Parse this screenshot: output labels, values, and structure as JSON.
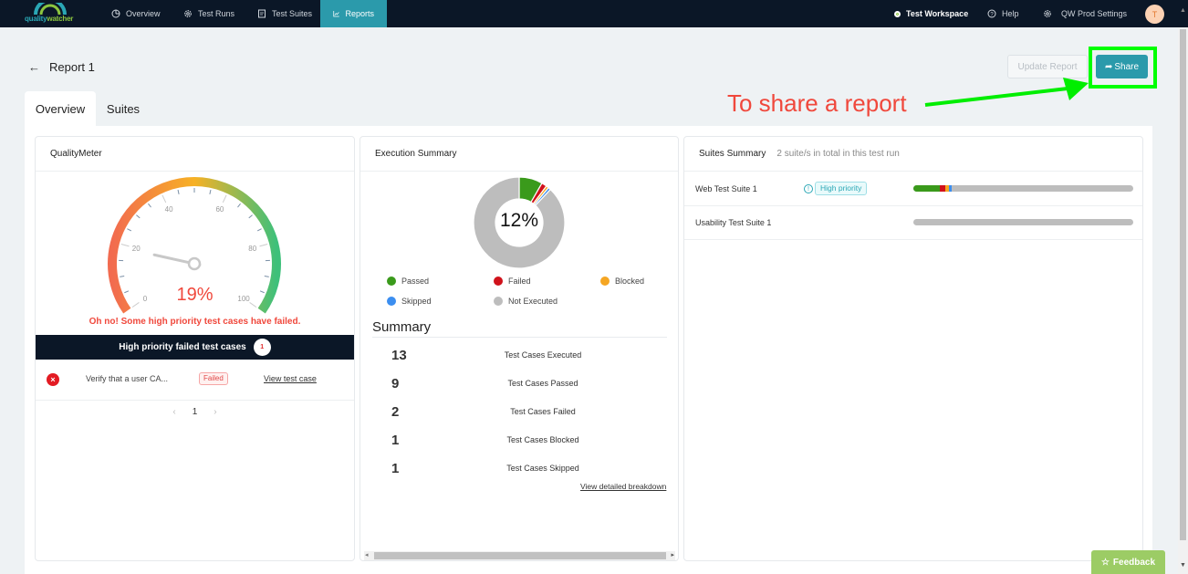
{
  "app": {
    "logo_part1": "quality",
    "logo_part2": "watcher"
  },
  "nav": {
    "items": [
      {
        "label": "Overview",
        "icon": "pie-chart-icon",
        "active": false
      },
      {
        "label": "Test Runs",
        "icon": "gear-icon",
        "active": false
      },
      {
        "label": "Test Suites",
        "icon": "clipboard-icon",
        "active": false
      },
      {
        "label": "Reports",
        "icon": "line-chart-icon",
        "active": true
      }
    ],
    "workspace": "Test Workspace",
    "help": "Help",
    "settings": "QW Prod Settings",
    "avatar_initial": "T"
  },
  "page": {
    "title": "Report 1",
    "update_button": "Update Report",
    "share_button": "Share",
    "annotation": "To share a report",
    "tabs": [
      {
        "label": "Overview",
        "active": true
      },
      {
        "label": "Suites",
        "active": false
      }
    ]
  },
  "quality_meter": {
    "title": "QualityMeter",
    "value_percent": 19,
    "value_label": "19%",
    "ticks": [
      "0",
      "20",
      "40",
      "60",
      "80",
      "100"
    ],
    "message": "Oh no! Some high priority test cases have failed.",
    "failed_header": "High priority failed test cases",
    "failed_count": "1",
    "failed_cases": [
      {
        "name": "Verify that a user CA...",
        "status": "Failed",
        "link": "View test case"
      }
    ],
    "pagination": {
      "current": "1",
      "prev": "‹",
      "next": "›"
    }
  },
  "execution_summary": {
    "title": "Execution Summary",
    "center_label": "12%",
    "colors": {
      "passed": "#3a9a1b",
      "failed": "#d0121b",
      "blocked": "#f5a623",
      "skipped": "#3b8ef0",
      "not_executed": "#bdbdbd"
    },
    "legend": [
      {
        "key": "passed",
        "label": "Passed"
      },
      {
        "key": "failed",
        "label": "Failed"
      },
      {
        "key": "blocked",
        "label": "Blocked"
      },
      {
        "key": "skipped",
        "label": "Skipped"
      },
      {
        "key": "not_executed",
        "label": "Not Executed"
      }
    ],
    "summary_title": "Summary",
    "rows": [
      {
        "value": "13",
        "label": "Test Cases Executed",
        "color": "#111111"
      },
      {
        "value": "9",
        "label": "Test Cases Passed",
        "color": "#3a9a1b"
      },
      {
        "value": "2",
        "label": "Test Cases Failed",
        "color": "#d0121b"
      },
      {
        "value": "1",
        "label": "Test Cases Blocked",
        "color": "#f5a623"
      },
      {
        "value": "1",
        "label": "Test Cases Skipped",
        "color": "#3b8ef0"
      }
    ],
    "breakdown_link": "View detailed breakdown"
  },
  "chart_data": {
    "type": "pie",
    "title": "Execution Summary",
    "center_label": "12%",
    "categories": [
      "Passed",
      "Failed",
      "Blocked",
      "Skipped",
      "Not Executed"
    ],
    "values": [
      9,
      2,
      1,
      1,
      95
    ]
  },
  "suites_summary": {
    "title": "Suites Summary",
    "subtitle": "2 suite/s in total in this test run",
    "suites": [
      {
        "name": "Web Test Suite 1",
        "priority": "High priority",
        "passed": 0.12,
        "failed": 0.027,
        "blocked": 0.013,
        "skipped": 0.013
      },
      {
        "name": "Usability Test Suite 1",
        "priority": "",
        "passed": 0,
        "failed": 0,
        "blocked": 0,
        "skipped": 0
      }
    ]
  },
  "feedback": {
    "label": "Feedback"
  }
}
